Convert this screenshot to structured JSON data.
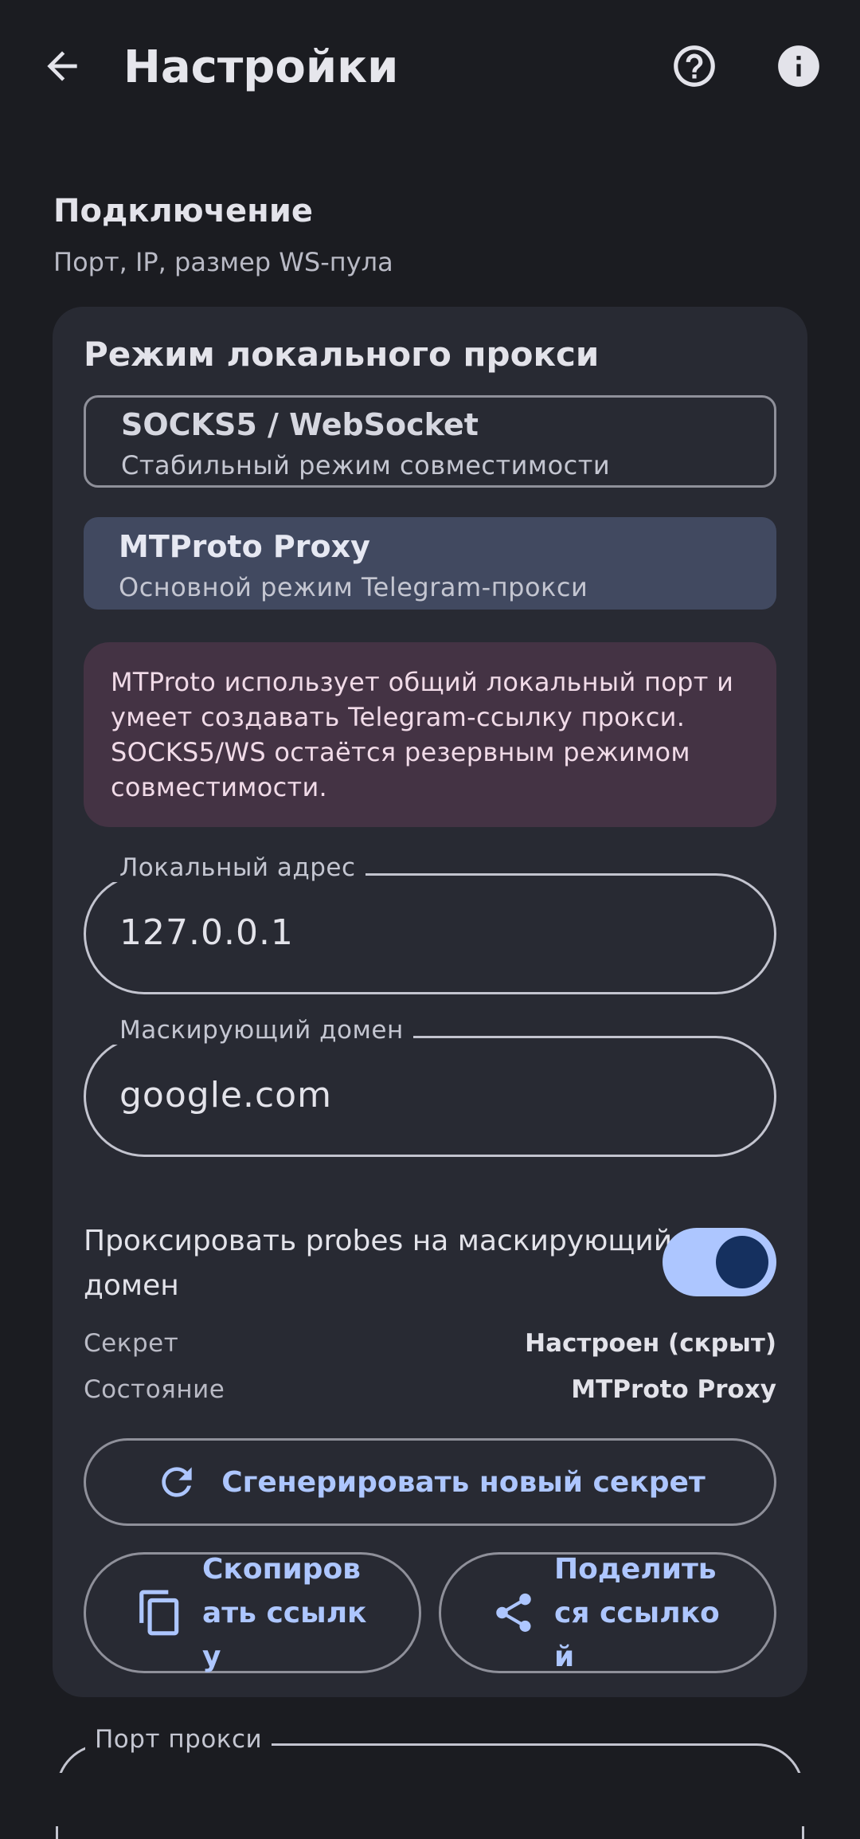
{
  "header": {
    "title": "Настройки",
    "icons": [
      "arrow-back-icon",
      "help-circle-icon",
      "info-icon"
    ]
  },
  "section": {
    "title": "Подключение",
    "subtitle": "Порт, IP, размер WS-пула"
  },
  "card": {
    "title": "Режим локального прокси",
    "modes": [
      {
        "name": "SOCKS5 / WebSocket",
        "description": "Стабильный режим совместимости",
        "selected": false
      },
      {
        "name": "MTProto Proxy",
        "description": "Основной режим Telegram-прокси",
        "selected": true
      }
    ],
    "notice": "MTProto использует общий локальный порт и умеет создавать Telegram-ссылку прокси. SOCKS5/WS остаётся резервным режимом совместимости.",
    "local_address": {
      "label": "Локальный адрес",
      "value": "127.0.0.1"
    },
    "mask_domain": {
      "label": "Маскирующий домен",
      "value": "google.com"
    },
    "probe_toggle": {
      "label": "Проксировать probes на маскирующий домен",
      "on": true
    },
    "secret": {
      "label": "Секрет",
      "value": "Настроен (скрыт)"
    },
    "status": {
      "label": "Состояние",
      "value": "MTProto Proxy"
    },
    "generate_button": "Сгенерировать новый секрет",
    "copy_button": "Скопировать ссылку",
    "share_button": "Поделиться ссылкой"
  },
  "next_field": {
    "label": "Порт прокси"
  },
  "colors": {
    "background": "#1b1c21",
    "card": "#282a33",
    "accent": "#adc6ff",
    "selected": "#414960",
    "notice_bg": "#443344"
  }
}
